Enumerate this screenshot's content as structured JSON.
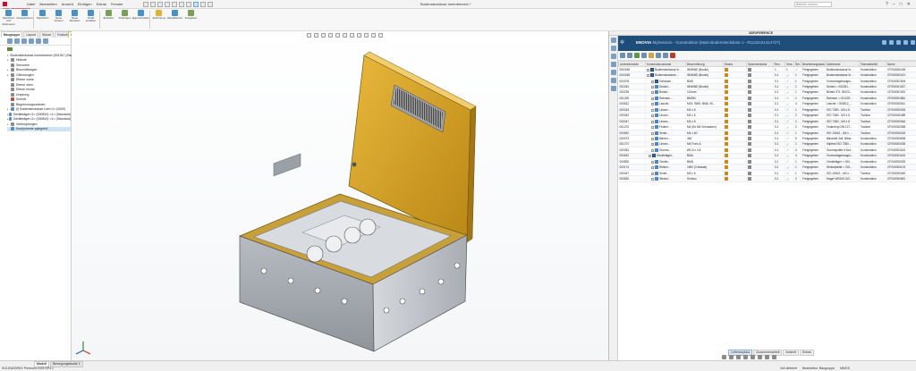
{
  "app": {
    "logo_text": "SOLIDWORKS",
    "document_title": "Bodensteckdose Innenbereich *",
    "search_placeholder": "Befehle suchen"
  },
  "menus": [
    "Datei",
    "Bearbeiten",
    "Ansicht",
    "Einfügen",
    "Extras",
    "Fenster"
  ],
  "window_controls": [
    "?",
    "–",
    "□",
    "✕"
  ],
  "ribbon": [
    {
      "label": "Speichern und Optimieren",
      "icon": "save-optimize-icon"
    },
    {
      "label": "Ausspeichern",
      "icon": "checkout-icon"
    },
    {
      "label": "Speichern",
      "icon": "save-icon"
    },
    {
      "label": "Neue Version",
      "icon": "new-version-icon"
    },
    {
      "label": "Neue Revision",
      "icon": "new-revision-icon"
    },
    {
      "label": "Inhalt erstellen",
      "icon": "create-content-icon"
    },
    {
      "label": "Erstellen",
      "icon": "create-icon"
    },
    {
      "label": "Prüfungen",
      "icon": "checks-icon"
    },
    {
      "label": "Eigenschaften",
      "icon": "properties-icon"
    },
    {
      "label": "Zeichnung",
      "icon": "drawing-icon"
    },
    {
      "label": "Aktualisieren",
      "icon": "refresh-icon"
    },
    {
      "label": "Freigeben",
      "icon": "release-icon"
    }
  ],
  "command_tabs": {
    "tabs": [
      "Baugruppe",
      "Layout",
      "Skizze",
      "Evaluieren"
    ],
    "active": 0,
    "tooltip": "Lifecycle und Collaboration"
  },
  "tree": [
    {
      "label": "Bodensteckdose Innenbereich (001347 (Standard<Anzeigestatus-1>)",
      "icon": "f",
      "exp": "▾"
    },
    {
      "label": "Historie",
      "icon": "g",
      "exp": "▸"
    },
    {
      "label": "Sensoren",
      "icon": "g",
      "exp": ""
    },
    {
      "label": "Beschriftungen",
      "icon": "g",
      "exp": "▸"
    },
    {
      "label": "Gleichungen",
      "icon": "g",
      "exp": "▸"
    },
    {
      "label": "Ebene vorne",
      "icon": "g",
      "exp": ""
    },
    {
      "label": "Ebene oben",
      "icon": "g",
      "exp": ""
    },
    {
      "label": "Ebene rechts",
      "icon": "g",
      "exp": ""
    },
    {
      "label": "Ursprung",
      "icon": "g",
      "exp": ""
    },
    {
      "label": "Schnitt",
      "icon": "r",
      "exp": ""
    },
    {
      "label": "Begrenzungsrahmen",
      "icon": "g",
      "exp": ""
    },
    {
      "label": "(f) Bodensteckdose Leer<1> (0000)",
      "icon": "b",
      "exp": "▸"
    },
    {
      "label": "Gerätetäger<1> (000810) <1> (Standard)",
      "icon": "b",
      "exp": "▸"
    },
    {
      "label": "Gerätetäger<2> (000810) <1> (Standard)",
      "icon": "b",
      "exp": "▸"
    },
    {
      "label": "Verknüpfungen",
      "icon": "g",
      "exp": "▸"
    },
    {
      "label": "Komponente spiegeln1",
      "icon": "b",
      "exp": ""
    }
  ],
  "right_panel": {
    "header": "3DEXPERIENCE",
    "banner_brand": "ENOVIA",
    "banner_title": "MySession - Konstruktion (Main Bodensteckdose 1 - R1132101414727)",
    "columns": [
      "Unterelemente",
      "Konstruktionsname",
      "Beschreibung",
      "Status",
      "Speicherstatus",
      "Rev.",
      "Vers.",
      "Rel.",
      "Bearbeitungsstatus",
      "Dateiname",
      "Teamaktivität",
      "Name"
    ],
    "rows": [
      [
        "000/248",
        "Bodensteckdose In...",
        "INNNNE (Bonitz)",
        "",
        "",
        "1",
        "1",
        "✓",
        "Freigegeben",
        "Bodensteckdose In...",
        "Konstruktion",
        "CF000000426"
      ],
      [
        "000/248",
        "Bodensteckdose...",
        "INNNNE (Bonitz)",
        "",
        "",
        "0.1",
        "✓",
        "1",
        "Freigegeben",
        "Bodensteckdose In...",
        "Konstruktion",
        "CF000000421"
      ],
      [
        "000078",
        "Gehäuse...",
        "BMS",
        "",
        "",
        "0.1",
        "✓",
        "1",
        "Freigegeben",
        "Vormontagebaugru...",
        "Konstruktion",
        "CF000001904"
      ],
      [
        "002261",
        "Deckel...",
        "INNNNE (Bonitz)",
        "",
        "",
        "0.1",
        "✓",
        "1",
        "Freigegeben",
        "Deckel = 002261...",
        "Konstruktion",
        "CF000001047"
      ],
      [
        "000239",
        "Bürste...",
        "110mm",
        "",
        "",
        "0.1",
        "✓",
        "1",
        "Freigegeben",
        "Bürste STL 00023...",
        "Konstruktion",
        "CF000001091"
      ],
      [
        "001220",
        "Rahmen...",
        "BMSM",
        "",
        "",
        "0.1",
        "✓",
        "1",
        "Freigegeben",
        "Rahmen = 001220...",
        "Konstruktion",
        "CF000001881"
      ],
      [
        "000812",
        "Lasche...",
        "M3X, BMS, BMA, BI...",
        "",
        "",
        "0.1",
        "✓",
        "4",
        "Freigegeben",
        "Lasche = 000812_...",
        "Konstruktion",
        "CF000000041"
      ],
      [
        "000243",
        "Linsen...",
        "M3 x 6",
        "",
        "",
        "0.1",
        "✓",
        "1",
        "Freigegeben",
        "ISO 7380 - M3 x 6",
        "Toolbox",
        "CF000000025"
      ],
      [
        "000042",
        "Linsen...",
        "M3 x 6",
        "",
        "",
        "0.1",
        "✓",
        "2",
        "Freigegeben",
        "ISO 7380 - M3 x 6",
        "Toolbox",
        "CF000000489"
      ],
      [
        "000047",
        "Linsen...",
        "M3 x 8",
        "",
        "",
        "0.1",
        "✓",
        "1",
        "Freigegeben",
        "ISO 7380 - M3 x 8",
        "Toolbox",
        "CF000000064"
      ],
      [
        "001270",
        "Federn...",
        "M4 (für M4 Schrauben)",
        "",
        "",
        "0.1",
        "✓",
        "2",
        "Freigegeben",
        "Federring DIN 127...",
        "Toolbox",
        "CF000000398"
      ],
      [
        "000810",
        "Senkt...",
        "M4 x 60",
        "",
        "",
        "0.1",
        "✓",
        "1",
        "Freigegeben",
        "ISO 10642 - M4 x ...",
        "Toolbox",
        "CF000000015"
      ],
      [
        "000073",
        "Blindni...",
        "3x8",
        "",
        "",
        "0.1",
        "✓",
        "9",
        "Freigegeben",
        "Blindniet 3x8, Blind...",
        "Konstruktion",
        "CF000000838"
      ],
      [
        "001707",
        "Linsen...",
        "M4 Form A",
        "",
        "",
        "0.1",
        "✓",
        "1",
        "Freigegeben",
        "Klipfest ISO 7380...",
        "Konstruktion",
        "CF000000035"
      ],
      [
        "000351",
        "Gummi...",
        "ØG.5 x 3.8",
        "",
        "",
        "0.1",
        "✓",
        "3",
        "Freigegeben",
        "Gummipuffer 6.5x3...",
        "Konstruktion",
        "CF000001105"
      ],
      [
        "000810",
        "Gerätetäger...",
        "BMA",
        "",
        "",
        "0.1",
        "✓",
        "4",
        "Freigegeben",
        "Vormontagebaugru...",
        "Konstruktion",
        "CF000001106"
      ],
      [
        "000820",
        "Geräte...",
        "BMA",
        "",
        "",
        "0.1",
        "✓",
        "1",
        "Freigegeben",
        "Gerätetäger = 000...",
        "Konstruktion",
        "CF000000033"
      ],
      [
        "000174",
        "Winkel...",
        "1800 (3 Absatz)",
        "",
        "",
        "0.1",
        "✓",
        "1",
        "Freigegeben",
        "Winkelplatte = 001...",
        "Konstruktion",
        "CF000000123"
      ],
      [
        "000047",
        "Senkt...",
        "M3 x 6",
        "",
        "",
        "0.1",
        "✓",
        "1",
        "Freigegeben",
        "ISO 10642 - M3 x ...",
        "Toolbox",
        "CF000000440"
      ],
      [
        "000820",
        "Steckd...",
        "Schuko",
        "",
        "",
        "0.1",
        "✓",
        "2",
        "Freigegeben",
        "Hager WS100-D/2...",
        "Konstruktion",
        "CF000000651"
      ]
    ],
    "bottom_tabs": [
      "Lebenszyklus",
      "Zusammenarbeit",
      "Ansicht",
      "Extras"
    ],
    "bottom_tabs_active": 0
  },
  "status": {
    "left": "SOLIDWORKS Premium 2023 SP4.1",
    "model_tabs": [
      "Modell",
      "Bewegungsstudie 1"
    ],
    "model_tab_active": 0,
    "right": [
      "Voll definiert",
      "Bearbeiten: Baugruppe",
      "MMGS"
    ]
  }
}
